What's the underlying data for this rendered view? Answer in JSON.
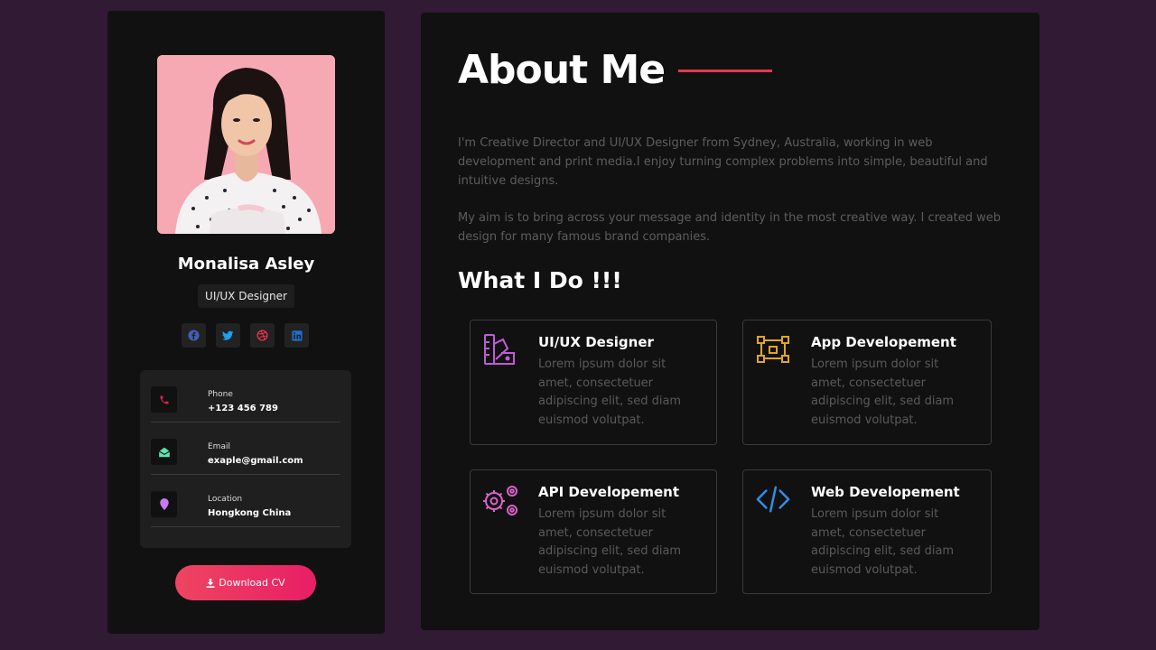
{
  "profile": {
    "name": "Monalisa Asley",
    "role": "UI/UX Designer",
    "socials": [
      "facebook-icon",
      "twitter-icon",
      "dribbble-icon",
      "linkedin-icon"
    ],
    "contacts": [
      {
        "label": "Phone",
        "value": "+123 456 789",
        "icon": "phone-icon",
        "color": "#e81e4f"
      },
      {
        "label": "Email",
        "value": "exaple@gmail.com",
        "icon": "envelope-icon",
        "color": "#5fe3b0"
      },
      {
        "label": "Location",
        "value": "Hongkong China",
        "icon": "location-pin-icon",
        "color": "#c57cf3"
      }
    ],
    "download_label": "Download CV"
  },
  "about": {
    "title": "About Me",
    "paragraph1": "I'm Creative Director and UI/UX Designer from Sydney, Australia, working in web development and print media.I enjoy turning complex problems into simple, beautiful and intuitive designs.",
    "paragraph2": "My aim is to bring across your message and identity in the most creative way. I created web design for many famous brand companies.",
    "what_i_do": "What I Do !!!",
    "services": [
      {
        "title": "UI/UX Designer",
        "desc": "Lorem ipsum dolor sit amet, consectetuer adipiscing elit, sed diam euismod volutpat.",
        "icon": "design-tools-icon",
        "color": "#c05cd6"
      },
      {
        "title": "App Developement",
        "desc": "Lorem ipsum dolor sit amet, consectetuer adipiscing elit, sed diam euismod volutpat.",
        "icon": "vector-nodes-icon",
        "color": "#e0a52a"
      },
      {
        "title": "API Developement",
        "desc": "Lorem ipsum dolor sit amet, consectetuer adipiscing elit, sed diam euismod volutpat.",
        "icon": "gears-icon",
        "color": "#d863c8"
      },
      {
        "title": "Web Developement",
        "desc": "Lorem ipsum dolor sit amet, consectetuer adipiscing elit, sed diam euismod volutpat.",
        "icon": "code-icon",
        "color": "#2f8fe6"
      }
    ]
  },
  "colors": {
    "background": "#311a33",
    "card": "#111111",
    "accent": "#e33a4f"
  }
}
